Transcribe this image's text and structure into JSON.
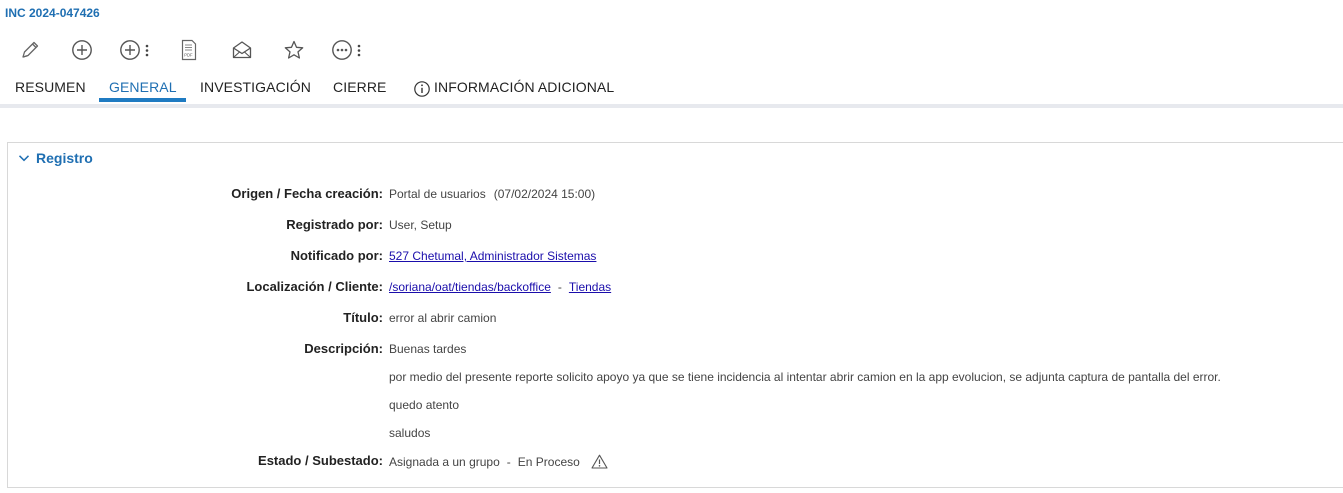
{
  "incident": {
    "id": "INC 2024-047426"
  },
  "toolbar": {
    "items": [
      {
        "name": "edit",
        "icon": "pencil-icon"
      },
      {
        "name": "add",
        "icon": "plus-circle-icon"
      },
      {
        "name": "add-menu",
        "icon": "plus-circle-icon"
      },
      {
        "name": "pdf",
        "icon": "pdf-icon"
      },
      {
        "name": "email",
        "icon": "envelope-open-icon"
      },
      {
        "name": "favorite",
        "icon": "star-icon"
      },
      {
        "name": "more",
        "icon": "ellipsis-circle-icon"
      }
    ]
  },
  "tabs": [
    {
      "label": "RESUMEN",
      "active": false
    },
    {
      "label": "GENERAL",
      "active": true
    },
    {
      "label": "INVESTIGACIÓN",
      "active": false
    },
    {
      "label": "CIERRE",
      "active": false
    },
    {
      "label": "INFORMACIÓN ADICIONAL",
      "active": false,
      "icon": "info-icon"
    }
  ],
  "section": {
    "title": "Registro",
    "fields": {
      "origen": {
        "label": "Origen / Fecha creación:",
        "value": "Portal de usuarios",
        "date": "(07/02/2024 15:00)"
      },
      "registrado": {
        "label": "Registrado por:",
        "value": "User, Setup"
      },
      "notificado": {
        "label": "Notificado por:",
        "value": "527 Chetumal, Administrador Sistemas"
      },
      "localizacion": {
        "label": "Localización / Cliente:",
        "location": "/soriana/oat/tiendas/backoffice",
        "separator": "-",
        "client": "Tiendas"
      },
      "titulo": {
        "label": "Título:",
        "value": "error al abrir camion"
      },
      "descripcion": {
        "label": "Descripción:",
        "lines": [
          "Buenas tardes",
          "por medio del presente reporte solicito apoyo ya que se tiene incidencia al intentar abrir camion en la app evolucion, se adjunta captura de pantalla del error.",
          "quedo atento",
          "saludos"
        ]
      },
      "estado": {
        "label": "Estado / Subestado:",
        "state": "Asignada a un grupo",
        "separator": "-",
        "substate": "En Proceso",
        "icon": "warning-icon"
      }
    }
  },
  "colors": {
    "accent": "#1f6fb2",
    "link": "#1a0dab",
    "tab_underline": "#1f7bc2"
  }
}
